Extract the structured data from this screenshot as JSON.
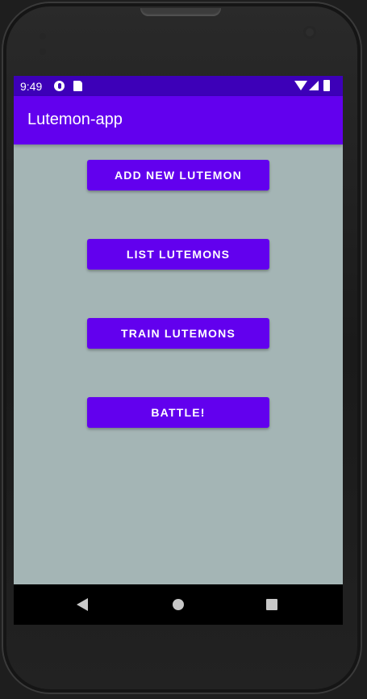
{
  "status_bar": {
    "time": "9:49",
    "left_icons": [
      "data-saver-icon",
      "sd-card-icon"
    ],
    "right_icons": [
      "wifi-icon",
      "cell-signal-icon",
      "battery-icon"
    ]
  },
  "app_bar": {
    "title": "Lutemon-app"
  },
  "main": {
    "buttons": [
      {
        "label": "ADD NEW LUTEMON"
      },
      {
        "label": "LIST LUTEMONS"
      },
      {
        "label": "TRAIN LUTEMONS"
      },
      {
        "label": "BATTLE!"
      }
    ]
  },
  "nav_bar": {
    "icons": [
      "back-icon",
      "home-icon",
      "recents-icon"
    ]
  },
  "colors": {
    "status_bar": "#3d00b8",
    "primary": "#6200ee",
    "background": "#a4b5b5",
    "nav_bar": "#000000"
  }
}
